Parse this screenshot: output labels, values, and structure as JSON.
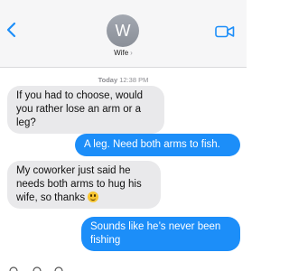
{
  "header": {
    "avatar_initial": "W",
    "contact_name": "Wife",
    "contact_chevron": "›",
    "back_icon": "chevron-left-icon",
    "video_icon": "video-camera-icon"
  },
  "thread": {
    "timestamp_day": "Today",
    "timestamp_time": "12:38 PM",
    "messages": [
      {
        "direction": "incoming",
        "text": "If you had to choose, would you rather lose an arm or a leg?"
      },
      {
        "direction": "outgoing",
        "text": "A leg. Need both arms to fish."
      },
      {
        "direction": "incoming",
        "text": "My coworker just said he needs both arms to hug his wife, so thanks",
        "emoji": "grimacing-face"
      },
      {
        "direction": "outgoing",
        "text": "Sounds like he’s never been fishing"
      }
    ]
  },
  "colors": {
    "accent": "#1c8ef9",
    "incoming_bubble": "#e9e9eb",
    "header_bg": "#f6f6f7"
  }
}
